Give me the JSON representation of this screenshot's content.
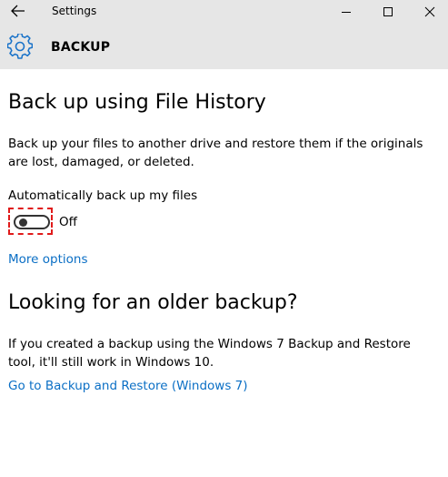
{
  "window": {
    "title": "Settings"
  },
  "header": {
    "title": "BACKUP"
  },
  "file_history": {
    "heading": "Back up using File History",
    "description": "Back up your files to another drive and restore them if the originals are lost, damaged, or deleted.",
    "auto_backup_label": "Automatically back up my files",
    "auto_backup_state": "Off",
    "auto_backup_on": false,
    "more_options_link": "More options"
  },
  "older_backup": {
    "heading": "Looking for an older backup?",
    "description": "If you created a backup using the Windows 7 Backup and Restore tool, it'll still work in Windows 10.",
    "restore_link": "Go to Backup and Restore (Windows 7)"
  },
  "icons": {
    "back": "back-arrow-icon",
    "minimize": "minimize-icon",
    "maximize": "maximize-icon",
    "close": "close-icon",
    "gear": "gear-icon"
  },
  "colors": {
    "accent": "#0b6fc5",
    "chrome_background": "#e6e6e6",
    "highlight_border": "#e01b1b"
  }
}
